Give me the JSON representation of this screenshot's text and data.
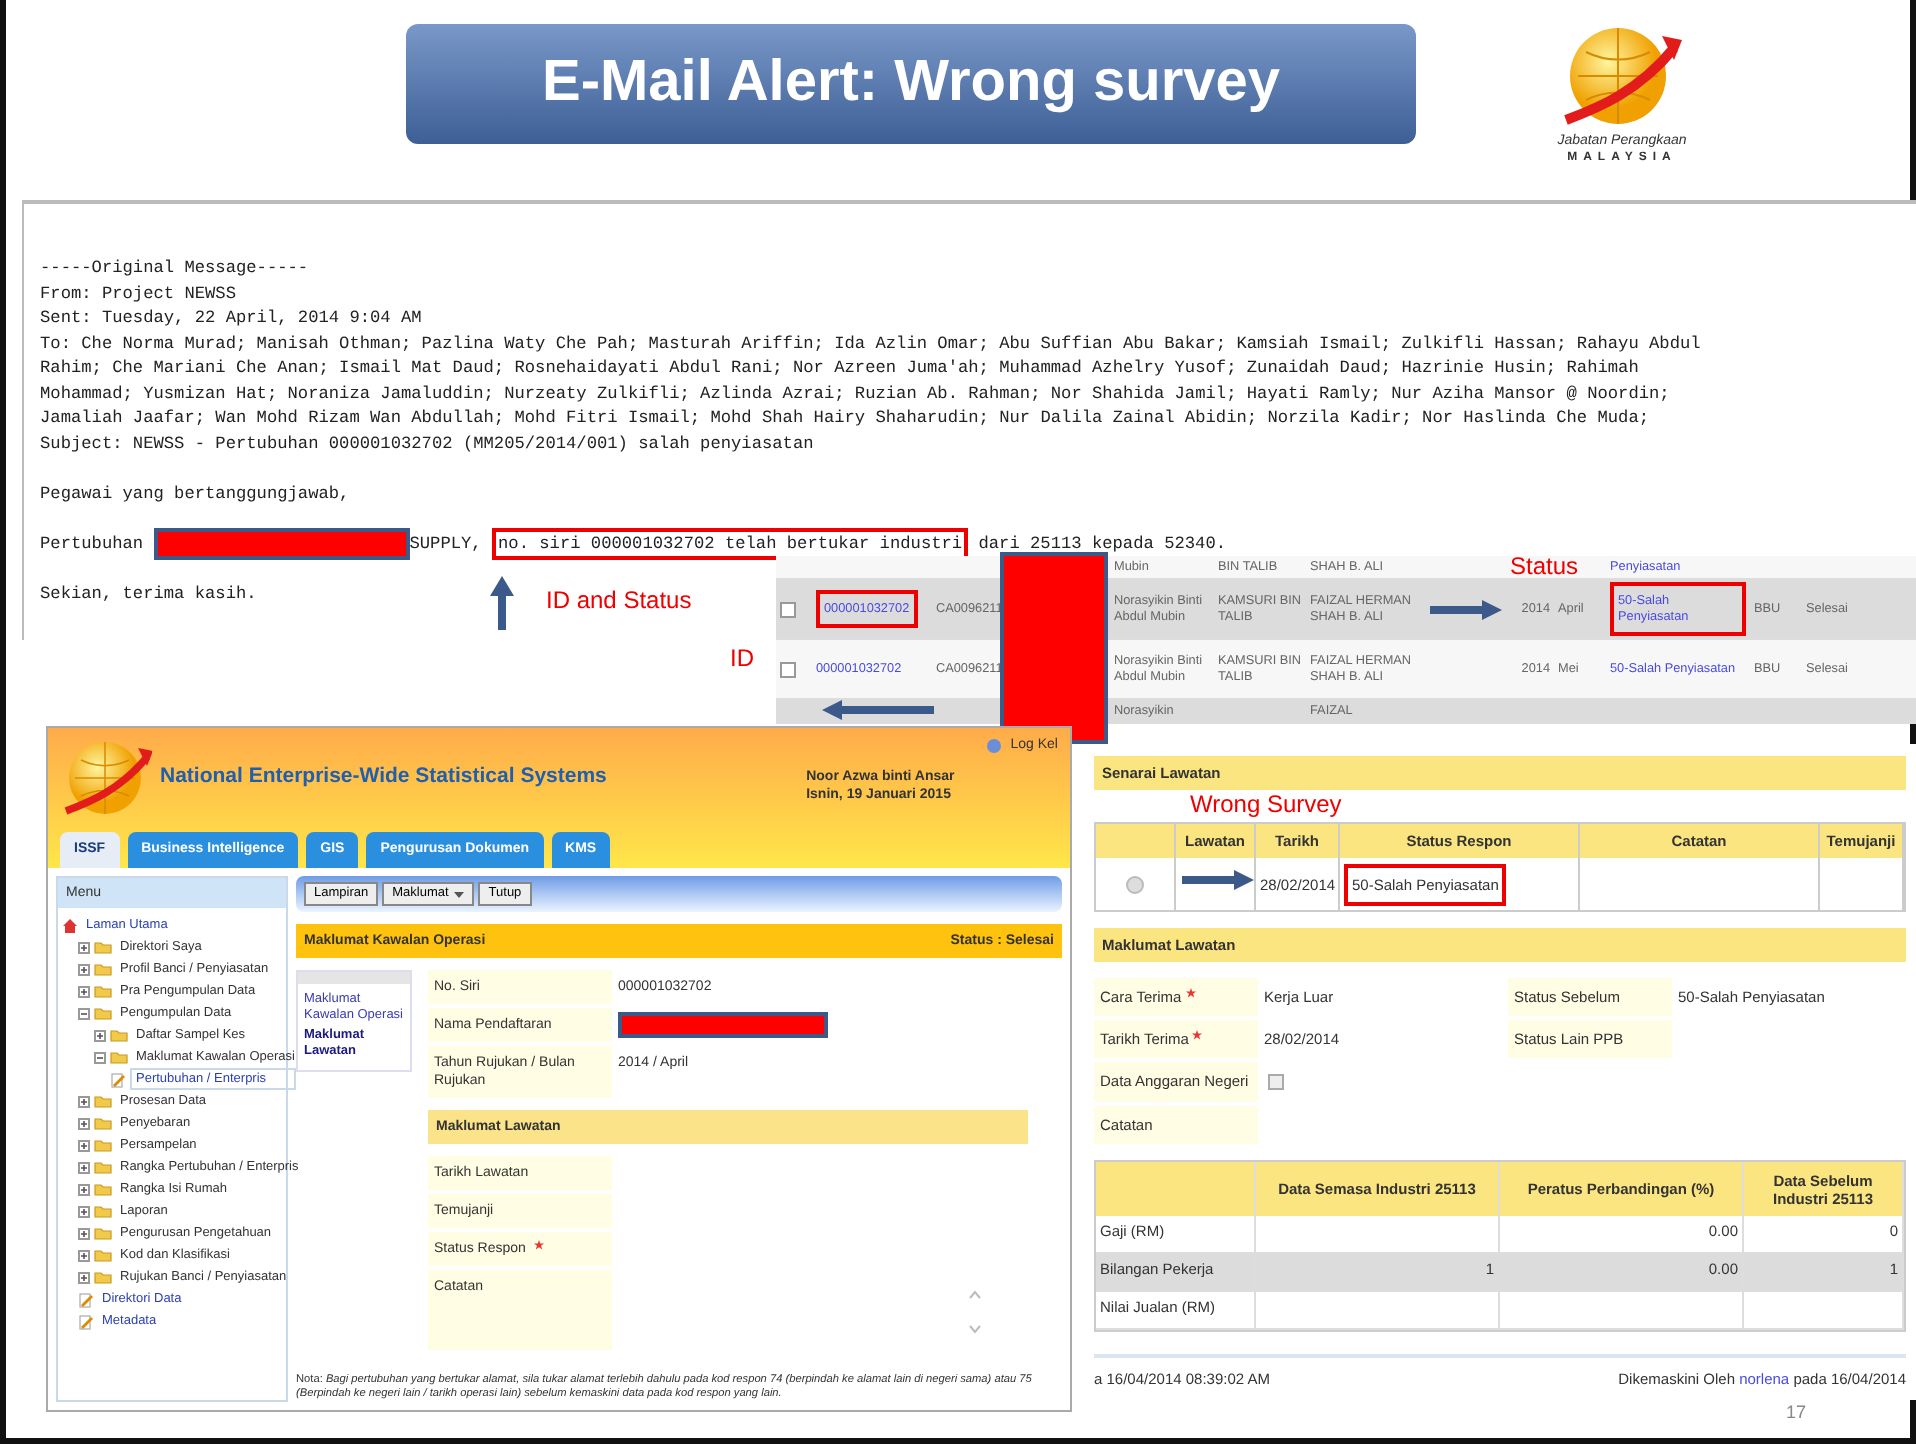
{
  "slide": {
    "title": "E-Mail Alert: Wrong survey",
    "logo_lines": [
      "Jabatan Perangkaan",
      "MALAYSIA"
    ],
    "page_number": "17"
  },
  "email": {
    "header_lines": [
      "-----Original Message-----",
      "From: Project NEWSS",
      "Sent: Tuesday, 22 April, 2014 9:04 AM",
      "To: Che Norma Murad; Manisah Othman; Pazlina Waty Che Pah; Masturah Ariffin; Ida Azlin Omar; Abu Suffian Abu Bakar; Kamsiah Ismail; Zulkifli Hassan; Rahayu Abdul",
      "Rahim; Che Mariani Che Anan; Ismail Mat Daud; Rosnehaidayati Abdul Rani; Nor Azreen Juma'ah; Muhammad Azhelry Yusof; Zunaidah Daud; Hazrinie Husin; Rahimah",
      "Mohammad; Yusmizan Hat; Noraniza Jamaluddin; Nurzeaty Zulkifli; Azlinda Azrai; Ruzian Ab. Rahman; Nor Shahida Jamil; Hayati Ramly; Nur Aziha Mansor @ Noordin;",
      "Jamaliah Jaafar; Wan Mohd Rizam Wan Abdullah; Mohd Fitri Ismail; Mohd Shah Hairy Shaharudin; Nur Dalila Zainal Abidin; Norzila Kadir; Nor Haslinda Che Muda;",
      "Subject: NEWSS - Pertubuhan 000001032702 (MM205/2014/001) salah penyiasatan"
    ],
    "greeting": "Pegawai yang bertanggungjawab,",
    "body": {
      "lead": "Pertubuhan",
      "after_redaction": "SUPPLY,",
      "highlight": "no. siri 000001032702 telah bertukar industri",
      "tail": "dari 25113 kepada 52340."
    },
    "closing": "Sekian, terima kasih."
  },
  "records": {
    "rows": [
      {
        "kind": "cut",
        "owner": "Mubin",
        "officer": "BIN TALIB",
        "supervisor": "SHAH B. ALI",
        "status": "Penyiasatan"
      },
      {
        "kind": "full",
        "checked": false,
        "id_boxed": true,
        "status_boxed": true,
        "id": "000001032702",
        "ref": "CA0096211",
        "owner": "Norasyikin Binti Abdul Mubin",
        "officer": "KAMSURI BIN TALIB",
        "supervisor": "FAIZAL HERMAN SHAH B. ALI",
        "year": "2014",
        "month": "April",
        "status": "50-Salah Penyiasatan",
        "unit": "BBU",
        "state": "Selesai"
      },
      {
        "kind": "full",
        "checked": false,
        "id_boxed": false,
        "status_boxed": false,
        "id": "000001032702",
        "ref": "CA0096211",
        "owner": "Norasyikin Binti Abdul Mubin",
        "officer": "KAMSURI BIN TALIB",
        "supervisor": "FAIZAL HERMAN SHAH B. ALI",
        "year": "2014",
        "month": "Mei",
        "status": "50-Salah Penyiasatan",
        "unit": "BBU",
        "state": "Selesai"
      },
      {
        "kind": "cut",
        "owner": "Norasyikin",
        "supervisor": "FAIZAL"
      }
    ]
  },
  "app": {
    "title": "National Enterprise-Wide Statistical Systems",
    "user": "Noor Azwa binti Ansar",
    "date": "Isnin, 19 Januari 2015",
    "logout": "Log Kel",
    "tabs": [
      {
        "label": "ISSF",
        "selected": true
      },
      {
        "label": "Business Intelligence",
        "selected": false
      },
      {
        "label": "GIS",
        "selected": false
      },
      {
        "label": "Pengurusan Dokumen",
        "selected": false
      },
      {
        "label": "KMS",
        "selected": false
      }
    ],
    "menu": {
      "title": "Menu",
      "items": [
        {
          "label": "Laman Utama",
          "kind": "home",
          "selected": false,
          "children": [
            {
              "label": "Direktori Saya",
              "kind": "folder",
              "expanded": false,
              "selected": false
            },
            {
              "label": "Profil Banci / Penyiasatan",
              "kind": "folder",
              "expanded": false,
              "selected": false
            },
            {
              "label": "Pra Pengumpulan Data",
              "kind": "folder",
              "expanded": false,
              "selected": false
            },
            {
              "label": "Pengumpulan Data",
              "kind": "folder",
              "expanded": true,
              "selected": false,
              "children": [
                {
                  "label": "Daftar Sampel Kes",
                  "kind": "folder",
                  "expanded": false,
                  "selected": false
                },
                {
                  "label": "Maklumat Kawalan Operasi",
                  "kind": "folder",
                  "expanded": true,
                  "selected": false,
                  "children": [
                    {
                      "label": "Pertubuhan / Enterpris",
                      "kind": "page",
                      "selected": true
                    }
                  ]
                }
              ]
            },
            {
              "label": "Prosesan Data",
              "kind": "folder",
              "expanded": false,
              "selected": false
            },
            {
              "label": "Penyebaran",
              "kind": "folder",
              "expanded": false,
              "selected": false
            },
            {
              "label": "Persampelan",
              "kind": "folder",
              "expanded": false,
              "selected": false
            },
            {
              "label": "Rangka Pertubuhan / Enterpris",
              "kind": "folder",
              "expanded": false,
              "selected": false
            },
            {
              "label": "Rangka Isi Rumah",
              "kind": "folder",
              "expanded": false,
              "selected": false
            },
            {
              "label": "Laporan",
              "kind": "folder",
              "expanded": false,
              "selected": false
            },
            {
              "label": "Pengurusan Pengetahuan",
              "kind": "folder",
              "expanded": false,
              "selected": false
            },
            {
              "label": "Kod dan Klasifikasi",
              "kind": "folder",
              "expanded": false,
              "selected": false
            },
            {
              "label": "Rujukan Banci / Penyiasatan",
              "kind": "folder",
              "expanded": false,
              "selected": false
            },
            {
              "label": "Direktori Data",
              "kind": "page",
              "selected": false
            },
            {
              "label": "Metadata",
              "kind": "page",
              "selected": false
            }
          ]
        }
      ]
    },
    "toolbar": [
      {
        "label": "Lampiran",
        "kind": "button"
      },
      {
        "label": "Maklumat",
        "kind": "dropdown"
      },
      {
        "label": "Tutup",
        "kind": "button"
      }
    ],
    "section": {
      "title": "Maklumat Kawalan Operasi",
      "status": "Status : Selesai"
    },
    "side_nav": [
      {
        "label": "Maklumat Kawalan Operasi",
        "selected": false
      },
      {
        "label": "Maklumat Lawatan",
        "selected": true
      }
    ],
    "fields": [
      {
        "label": "No. Siri",
        "kind": "text",
        "value": "000001032702"
      },
      {
        "label": "Nama Pendaftaran",
        "kind": "redacted"
      },
      {
        "label": "Tahun Rujukan / Bulan Rujukan",
        "kind": "text",
        "value": "2014 / April"
      }
    ],
    "visit": {
      "title": "Maklumat Lawatan",
      "fields": [
        {
          "label": "Tarikh Lawatan",
          "kind": "line",
          "required": false
        },
        {
          "label": "Temujanji",
          "kind": "line",
          "required": false
        },
        {
          "label": "Status Respon",
          "kind": "line",
          "required": true
        },
        {
          "label": "Catatan",
          "kind": "textarea",
          "required": false
        }
      ]
    },
    "note": "Nota: *Bagi pertubuhan yang bertukar alamat, sila tukar alamat terlebih dahulu pada kod respon 74 (berpindah ke alamat lain di negeri sama) atau 75 (Berpindah ke negeri lain / tarikh operasi lain) sebelum kemaskini data pada kod respon yang lain.*"
  },
  "detail": {
    "visit_list": {
      "title": "Senarai Lawatan",
      "columns": [
        "Lawatan",
        "Tarikh",
        "Status Respon",
        "Catatan",
        "Temujanji"
      ],
      "rows": [
        {
          "selected": false,
          "boxed": true,
          "date": "28/02/2014",
          "status": "50-Salah Penyiasatan"
        }
      ]
    },
    "visit_info": {
      "title": "Maklumat Lawatan",
      "fields": [
        {
          "label": "Cara Terima",
          "kind": "text",
          "required": true,
          "value": "Kerja Luar"
        },
        {
          "label": "Status Sebelum",
          "kind": "text",
          "required": false,
          "value": "50-Salah Penyiasatan"
        },
        {
          "label": "Tarikh Terima",
          "kind": "text",
          "required": true,
          "value": "28/02/2014"
        },
        {
          "label": "Status Lain PPB",
          "kind": "text",
          "required": false
        },
        {
          "label": "Data Anggaran Negeri",
          "kind": "checkbox",
          "required": false,
          "checked": false
        },
        {
          "label": "Catatan",
          "kind": "text",
          "required": false
        }
      ]
    },
    "comparison": {
      "columns": [
        "Data Semasa Industri 25113",
        "Peratus Perbandingan (%)",
        "Data Sebelum Industri 25113"
      ],
      "rows": [
        {
          "label": "Gaji (RM)",
          "percent": "0.00",
          "previous": "0"
        },
        {
          "label": "Bilangan Pekerja",
          "current": "1",
          "percent": "0.00",
          "previous": "1"
        },
        {
          "label": "Nilai Jualan (RM)"
        }
      ]
    },
    "footer": {
      "created": "a 16/04/2014 08:39:02 AM",
      "updated_prefix": "Dikemaskini Oleh",
      "updated_by": "norlena",
      "updated_suffix": "pada 16/04/2014"
    }
  },
  "annotations": [
    {
      "kind": "label",
      "text": "ID and Status"
    },
    {
      "kind": "arrow_up"
    },
    {
      "kind": "label",
      "text": "ID"
    },
    {
      "kind": "arrow_left"
    },
    {
      "kind": "label",
      "text": "Status"
    },
    {
      "kind": "arrow_right"
    },
    {
      "kind": "label",
      "text": "Wrong Survey"
    },
    {
      "kind": "arrow_right"
    }
  ]
}
